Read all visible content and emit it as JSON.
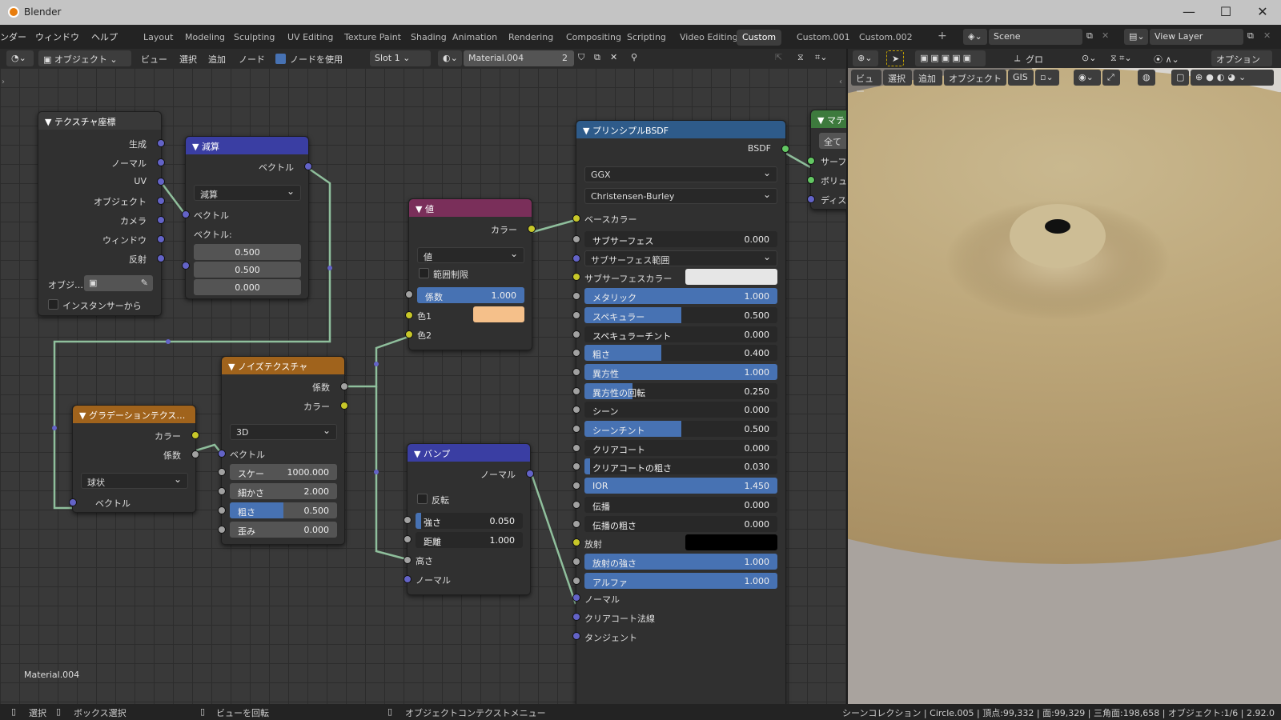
{
  "app": {
    "title": "Blender",
    "minimize": "—",
    "maximize": "☐",
    "close": "✕"
  },
  "menus": [
    "ンダー",
    "ウィンドウ",
    "ヘルプ"
  ],
  "workspaces": [
    "Layout",
    "Modeling",
    "Sculpting",
    "UV Editing",
    "Texture Paint",
    "Shading",
    "Animation",
    "Rendering",
    "Compositing",
    "Scripting",
    "Video Editing",
    "Custom",
    "Custom.001",
    "Custom.002"
  ],
  "active_workspace": "Custom",
  "scene": {
    "name": "Scene",
    "view_layer": "View Layer",
    "add": "+"
  },
  "node_header": {
    "mode": "オブジェクト",
    "menu": [
      "ビュー",
      "選択",
      "追加",
      "ノード"
    ],
    "use_nodes": "ノードを使用",
    "slot": "Slot 1",
    "material": "Material.004",
    "users": "2"
  },
  "viewport_header": {
    "global": "グロー…",
    "options": "オプション",
    "menu": [
      "ビュー",
      "選択",
      "追加",
      "オブジェクト",
      "GIS"
    ]
  },
  "material_label": "Material.004",
  "nodes": {
    "texcoord": {
      "title": "テクスチャ座標",
      "outputs": [
        "生成",
        "ノーマル",
        "UV",
        "オブジェクト",
        "カメラ",
        "ウィンドウ",
        "反射"
      ],
      "obj_label": "オブジ…",
      "instancer": "インスタンサーから"
    },
    "subtract": {
      "title": "減算",
      "out": "ベクトル",
      "op": "減算",
      "in1": "ベクトル",
      "in2": "ベクトル:",
      "values": [
        "0.500",
        "0.500",
        "0.000"
      ]
    },
    "value": {
      "title": "値",
      "out": "カラー",
      "mode": "値",
      "clamp": "範囲制限",
      "fac_label": "係数",
      "fac": "1.000",
      "c1": "色1",
      "c2": "色2",
      "c1_color": "#f5c08a"
    },
    "noise": {
      "title": "ノイズテクスチャ",
      "outs": [
        "係数",
        "カラー"
      ],
      "dim": "3D",
      "vec": "ベクトル",
      "rows": [
        {
          "l": "スケー",
          "v": "1000.000",
          "f": 0
        },
        {
          "l": "細かさ",
          "v": "2.000",
          "f": 0
        },
        {
          "l": "粗さ",
          "v": "0.500",
          "f": 0.5
        },
        {
          "l": "歪み",
          "v": "0.000",
          "f": 0
        }
      ]
    },
    "gradient": {
      "title": "グラデーションテクス…",
      "outs": [
        "カラー",
        "係数"
      ],
      "type": "球状",
      "vec": "ベクトル"
    },
    "bump": {
      "title": "バンプ",
      "out": "ノーマル",
      "invert": "反転",
      "rows": [
        {
          "l": "強さ",
          "v": "0.050",
          "f": 0.05
        },
        {
          "l": "距離",
          "v": "1.000",
          "f": 0
        }
      ],
      "height": "高さ",
      "normal": "ノーマル"
    },
    "bsdf": {
      "title": "プリンシプルBSDF",
      "out": "BSDF",
      "dist": "GGX",
      "sss": "Christensen-Burley",
      "base": "ベースカラー",
      "rows": [
        {
          "l": "サブサーフェス",
          "v": "0.000",
          "f": 0
        },
        {
          "l": "サブサーフェス範囲",
          "v": "",
          "dd": true
        },
        {
          "l": "サブサーフェスカラー",
          "v": "",
          "sw": "#e6e6e6"
        },
        {
          "l": "メタリック",
          "v": "1.000",
          "f": 1
        },
        {
          "l": "スペキュラー",
          "v": "0.500",
          "f": 0.5
        },
        {
          "l": "スペキュラーチント",
          "v": "0.000",
          "f": 0
        },
        {
          "l": "粗さ",
          "v": "0.400",
          "f": 0.4
        },
        {
          "l": "異方性",
          "v": "1.000",
          "f": 1
        },
        {
          "l": "異方性の回転",
          "v": "0.250",
          "f": 0.25
        },
        {
          "l": "シーン",
          "v": "0.000",
          "f": 0
        },
        {
          "l": "シーンチント",
          "v": "0.500",
          "f": 0.5
        },
        {
          "l": "クリアコート",
          "v": "0.000",
          "f": 0
        },
        {
          "l": "クリアコートの粗さ",
          "v": "0.030",
          "f": 0.03
        },
        {
          "l": "IOR",
          "v": "1.450",
          "f": 1
        },
        {
          "l": "伝播",
          "v": "0.000",
          "f": 0
        },
        {
          "l": "伝播の粗さ",
          "v": "0.000",
          "f": 0
        },
        {
          "l": "放射",
          "v": "",
          "sw": "#000000"
        },
        {
          "l": "放射の強さ",
          "v": "1.000",
          "f": 1
        },
        {
          "l": "アルファ",
          "v": "1.000",
          "f": 1
        }
      ],
      "tail": [
        "ノーマル",
        "クリアコート法線",
        "タンジェント"
      ]
    },
    "output": {
      "title": "マテ",
      "btn": "全て",
      "rows": [
        "サーフ",
        "ボリュ",
        "ディス"
      ]
    }
  },
  "status": {
    "left": [
      "選択",
      "ボックス選択",
      "ビューを回転",
      "オブジェクトコンテクストメニュー"
    ],
    "right": "シーンコレクション | Circle.005 | 頂点:99,332 | 面:99,329 | 三角面:198,658 | オブジェクト:1/6 | 2.92.0"
  }
}
